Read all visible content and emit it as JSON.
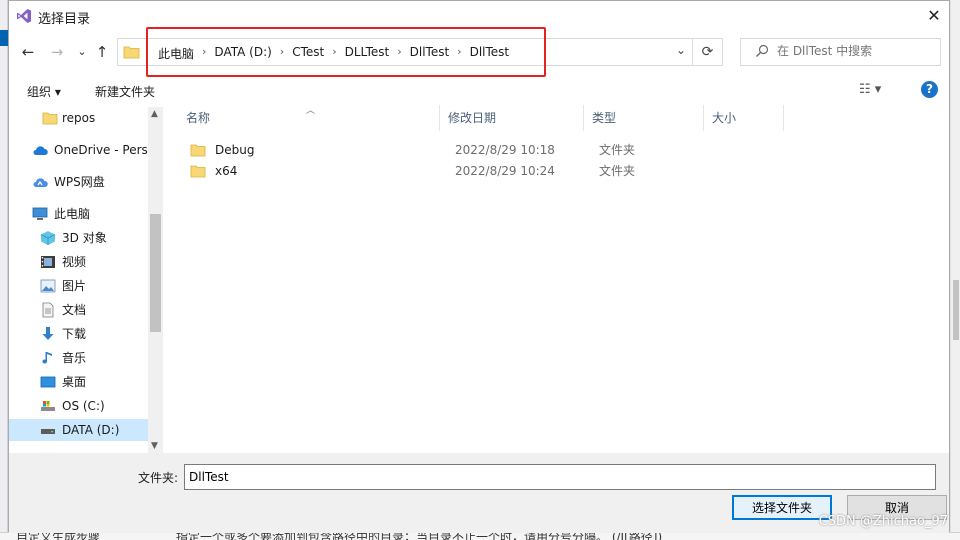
{
  "window": {
    "title": "选择目录",
    "close": "✕"
  },
  "address": {
    "crumbs": [
      "此电脑",
      "DATA (D:)",
      "CTest",
      "DLLTest",
      "DllTest",
      "DllTest"
    ],
    "separator": "›",
    "dropdown": "⌄",
    "refresh": "⟳",
    "highlight_color": "#e62121"
  },
  "nav_buttons": {
    "back": "←",
    "forward": "→",
    "recent": "⌄",
    "up": "↑"
  },
  "search": {
    "placeholder": "在 DllTest 中搜索"
  },
  "toolbar": {
    "organize": "组织 ▾",
    "new_folder": "新建文件夹",
    "view": "☷ ▾",
    "help": "?"
  },
  "nav_pane": [
    {
      "label": "repos",
      "icon": "folder-icon"
    },
    {
      "label": "OneDrive - Personal",
      "icon": "cloud-icon"
    },
    {
      "label": "WPS网盘",
      "icon": "wps-cloud-icon"
    },
    {
      "label": "此电脑",
      "icon": "computer-icon"
    },
    {
      "label": "3D 对象",
      "icon": "cube-icon"
    },
    {
      "label": "视频",
      "icon": "video-icon"
    },
    {
      "label": "图片",
      "icon": "picture-icon"
    },
    {
      "label": "文档",
      "icon": "document-icon"
    },
    {
      "label": "下载",
      "icon": "download-icon"
    },
    {
      "label": "音乐",
      "icon": "music-icon"
    },
    {
      "label": "桌面",
      "icon": "desktop-icon"
    },
    {
      "label": "OS (C:)",
      "icon": "drive-icon"
    },
    {
      "label": "DATA (D:)",
      "icon": "drive-icon",
      "selected": true
    }
  ],
  "columns": [
    "名称",
    "修改日期",
    "类型",
    "大小"
  ],
  "files": [
    {
      "name": "Debug",
      "date": "2022/8/29 10:18",
      "type": "文件夹"
    },
    {
      "name": "x64",
      "date": "2022/8/29 10:24",
      "type": "文件夹"
    }
  ],
  "footer": {
    "folder_label": "文件夹:",
    "folder_value": "DllTest",
    "select_button": "选择文件夹",
    "cancel_button": "取消"
  },
  "background": {
    "bottom_text": "指定一个或多个要添加到包含路径中的目录；当目录不止一个时，请用分号分隔。   (/I[路径])",
    "bottom_left_text": "自定义生成步骤"
  },
  "watermark": "CSDN @Zhichao_97"
}
